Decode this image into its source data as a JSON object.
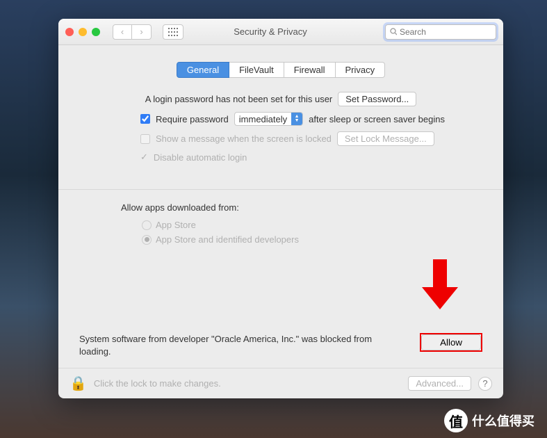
{
  "window": {
    "title": "Security & Privacy",
    "search_placeholder": "Search"
  },
  "tabs": [
    "General",
    "FileVault",
    "Firewall",
    "Privacy"
  ],
  "general": {
    "no_password": "A login password has not been set for this user",
    "set_password": "Set Password...",
    "require_password_pre": "Require password",
    "require_password_select": "immediately",
    "require_password_post": "after sleep or screen saver begins",
    "show_message": "Show a message when the screen is locked",
    "set_lock_msg": "Set Lock Message...",
    "disable_auto_login": "Disable automatic login",
    "allow_from_label": "Allow apps downloaded from:",
    "radio_appstore": "App Store",
    "radio_identified": "App Store and identified developers",
    "blocked_msg": "System software from developer \"Oracle America, Inc.\" was blocked from loading.",
    "allow": "Allow"
  },
  "footer": {
    "lock_msg": "Click the lock to make changes.",
    "advanced": "Advanced..."
  },
  "watermark": {
    "badge": "值",
    "text": "什么值得买"
  }
}
